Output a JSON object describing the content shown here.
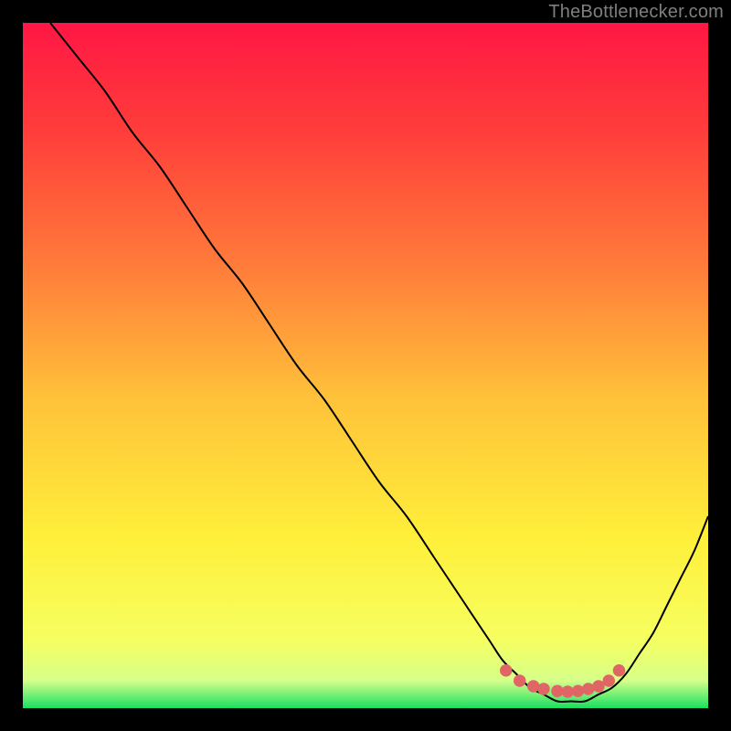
{
  "watermark": "TheBottlenecker.com",
  "chart_data": {
    "type": "line",
    "title": "",
    "xlabel": "",
    "ylabel": "",
    "xlim": [
      0,
      100
    ],
    "ylim": [
      0,
      100
    ],
    "grid": false,
    "gradient_stops": [
      {
        "offset": 0,
        "color": "#ff1744"
      },
      {
        "offset": 15,
        "color": "#ff3b3b"
      },
      {
        "offset": 35,
        "color": "#ff7a3a"
      },
      {
        "offset": 55,
        "color": "#ffc23a"
      },
      {
        "offset": 75,
        "color": "#ffef3a"
      },
      {
        "offset": 90,
        "color": "#f6ff60"
      },
      {
        "offset": 96,
        "color": "#d6ff8a"
      },
      {
        "offset": 100,
        "color": "#18e060"
      }
    ],
    "series": [
      {
        "name": "bottleneck-curve",
        "type": "line",
        "color": "#000000",
        "x": [
          4,
          8,
          12,
          16,
          20,
          24,
          28,
          32,
          36,
          40,
          44,
          48,
          52,
          56,
          60,
          64,
          68,
          70,
          72,
          74,
          76,
          78,
          80,
          82,
          84,
          86,
          88,
          90,
          92,
          94,
          96,
          98,
          100
        ],
        "y": [
          100,
          95,
          90,
          84,
          79,
          73,
          67,
          62,
          56,
          50,
          45,
          39,
          33,
          28,
          22,
          16,
          10,
          7,
          5,
          3,
          2,
          1,
          1,
          1,
          2,
          3,
          5,
          8,
          11,
          15,
          19,
          23,
          28
        ]
      },
      {
        "name": "optimal-markers",
        "type": "scatter",
        "color": "#e06666",
        "x": [
          70.5,
          72.5,
          74.5,
          76.0,
          78.0,
          79.5,
          81.0,
          82.5,
          84.0,
          85.5,
          87.0
        ],
        "y": [
          5.5,
          4.0,
          3.2,
          2.8,
          2.5,
          2.4,
          2.5,
          2.8,
          3.2,
          4.0,
          5.5
        ]
      }
    ]
  }
}
